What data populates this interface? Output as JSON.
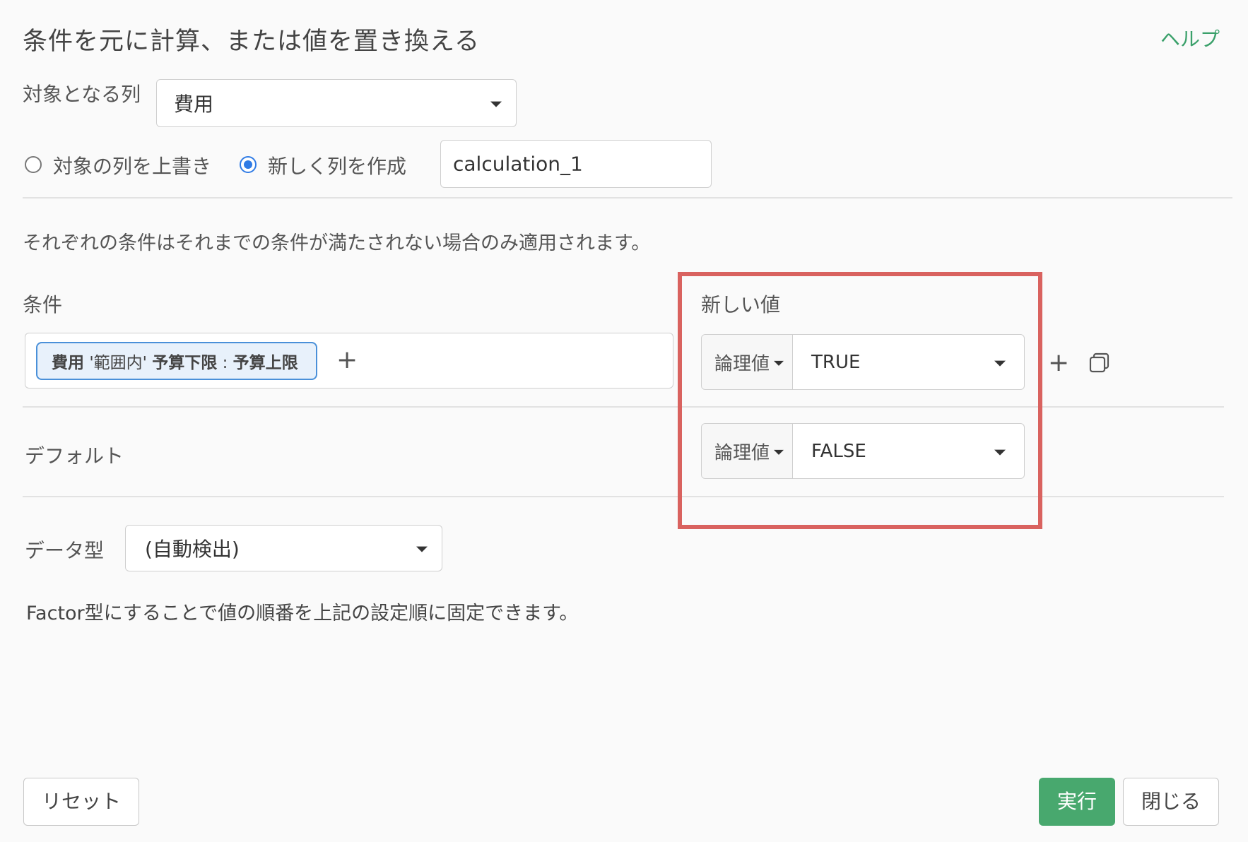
{
  "header": {
    "title": "条件を元に計算、または値を置き換える",
    "help_label": "ヘルプ"
  },
  "target_column": {
    "label": "対象となる列",
    "value": "費用"
  },
  "mode": {
    "overwrite_label": "対象の列を上書き",
    "create_label": "新しく列を作成",
    "selected": "create",
    "new_column_name": "calculation_1"
  },
  "description": "それぞれの条件はそれまでの条件が満たされない場合のみ適用されます。",
  "conditions": {
    "header_label": "条件",
    "new_value_header": "新しい値",
    "rows": [
      {
        "chip": {
          "column": "費用",
          "op": "'範囲内'",
          "low": "予算下限",
          "sep": ":",
          "high": "予算上限"
        },
        "value_type": "論理値",
        "value": "TRUE"
      }
    ]
  },
  "default": {
    "label": "デフォルト",
    "value_type": "論理値",
    "value": "FALSE"
  },
  "data_type": {
    "label": "データ型",
    "value": "(自動検出)"
  },
  "factor_note": "Factor型にすることで値の順番を上記の設定順に固定できます。",
  "footer": {
    "reset_label": "リセット",
    "run_label": "実行",
    "close_label": "閉じる"
  },
  "colors": {
    "accent_green": "#48a86e",
    "chip_border": "#4a90d9",
    "highlight_red": "#d9625f",
    "radio_blue": "#2f7be5"
  }
}
